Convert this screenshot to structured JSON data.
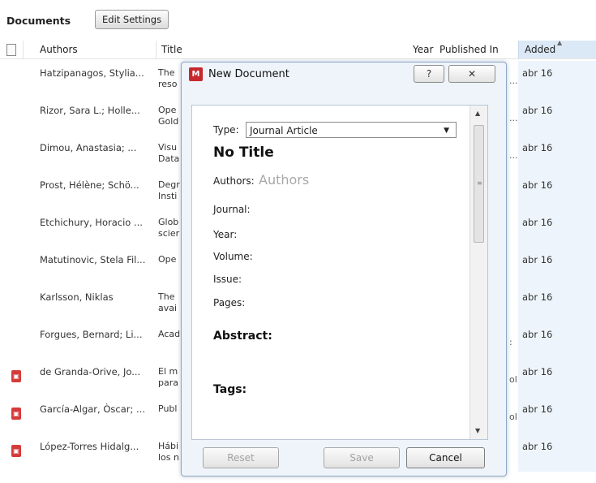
{
  "toolbar": {
    "title": "Documents",
    "edit_settings_label": "Edit Settings"
  },
  "columns": {
    "authors": "Authors",
    "title": "Title",
    "year": "Year",
    "published_in": "Published In",
    "added": "Added"
  },
  "rows": [
    {
      "authors": "Hatzipanagos, Stylia...",
      "title1": "The",
      "title2": "reso",
      "added": "abr 16",
      "pdf": false,
      "pub": "..."
    },
    {
      "authors": "Rizor, Sara L.; Holle...",
      "title1": "Ope",
      "title2": "Gold",
      "added": "abr 16",
      "pdf": false,
      "pub": "..."
    },
    {
      "authors": "Dimou, Anastasia; ...",
      "title1": "Visu",
      "title2": "Data",
      "added": "abr 16",
      "pdf": false,
      "pub": "..."
    },
    {
      "authors": "Prost, Hélène; Schö...",
      "title1": "Degr",
      "title2": "Insti",
      "added": "abr 16",
      "pdf": false,
      "pub": ""
    },
    {
      "authors": "Etchichury, Horacio ...",
      "title1": "Glob",
      "title2": "scier",
      "added": "abr 16",
      "pdf": false,
      "pub": ""
    },
    {
      "authors": "Matutinovic, Stela Fil...",
      "title1": "Ope",
      "title2": "",
      "added": "abr 16",
      "pdf": false,
      "pub": ""
    },
    {
      "authors": "Karlsson, Niklas",
      "title1": "The",
      "title2": "avai",
      "added": "abr 16",
      "pdf": false,
      "pub": ""
    },
    {
      "authors": "Forgues, Bernard; Li...",
      "title1": "Acad",
      "title2": "",
      "added": "abr 16",
      "pdf": false,
      "pub": ":"
    },
    {
      "authors": "de Granda-Orive, Jo...",
      "title1": "El m",
      "title2": "para",
      "added": "abr 16",
      "pdf": true,
      "pub": "ol"
    },
    {
      "authors": "García-Algar, Òscar; ...",
      "title1": "Publ",
      "title2": "",
      "added": "abr 16",
      "pdf": true,
      "pub": "ol"
    },
    {
      "authors": "López-Torres Hidalg...",
      "title1": "Hábi",
      "title2": "los n",
      "added": "abr 16",
      "pdf": true,
      "pub": ""
    }
  ],
  "dialog": {
    "title": "New Document",
    "help_label": "?",
    "close_label": "✕",
    "type_label": "Type:",
    "type_value": "Journal Article",
    "doc_title": "No Title",
    "authors_label": "Authors:",
    "authors_placeholder": "Authors",
    "fields": [
      "Journal:",
      "Year:",
      "Volume:",
      "Issue:",
      "Pages:"
    ],
    "abstract_label": "Abstract:",
    "tags_label": "Tags:",
    "reset_label": "Reset",
    "save_label": "Save",
    "cancel_label": "Cancel"
  },
  "icons": {
    "app": "mendeley-icon",
    "pdf": "pdf-icon",
    "doc": "document-icon"
  },
  "colors": {
    "selected_column": "#dbe9f7",
    "pdf_icon": "#d63b3b",
    "app_icon": "#c7282e"
  }
}
